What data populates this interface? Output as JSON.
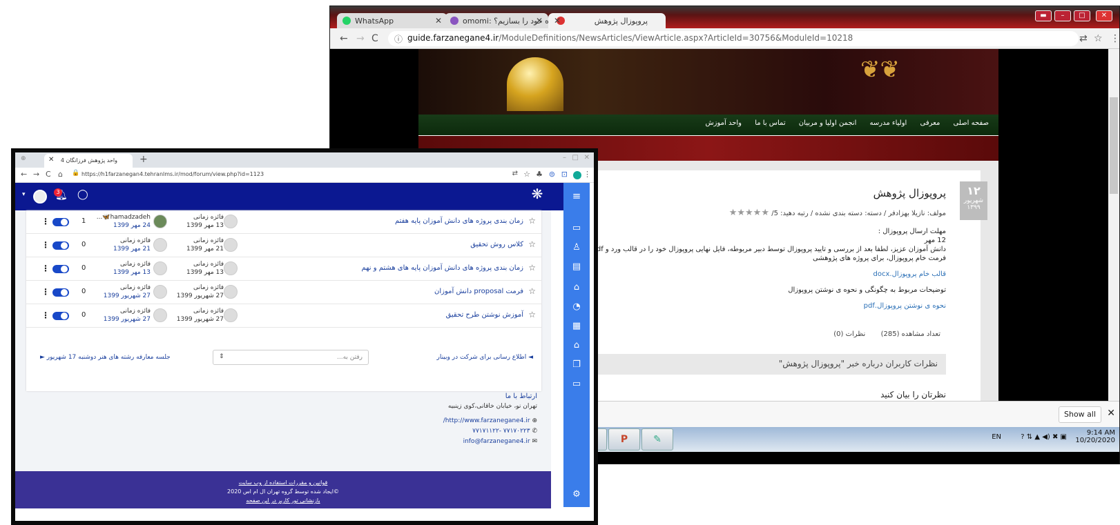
{
  "back": {
    "tabs": [
      {
        "label": "WhatsApp",
        "color": "#25d366"
      },
      {
        "label": "omomi: ه خود را بسازیم؟",
        "color": "#8a55c0"
      },
      {
        "label": "پروپوزال پژوهش",
        "color": "#d33"
      }
    ],
    "url_host": "guide.farzanegane4.ir",
    "url_path": "/ModuleDefinitions/NewsArticles/ViewArticle.aspx?ArticleId=30756&ModuleId=10218",
    "menu": [
      "صفحه اصلی",
      "معرفی",
      "اولیاء مدرسه",
      "انجمن اولیا و مربیان",
      "تماس با ما",
      "واحد آموزش"
    ],
    "date": {
      "day": "۱۲",
      "month": "شهریور",
      "year": "۱۳۹۹"
    },
    "title": "پروپوزال پژوهش",
    "meta": "مولف: نازیلا بهزادفر  /  دسته: دسته بندی نشده  /  رتبه دهید: 5/",
    "deadline_label": "مهلت ارسال پروپوزال :",
    "deadline_date": "12 مهر",
    "body": "دانش آموزان عزیز، لطفا بعد از  بررسی و تایید پروپوزال توسط دبیر مربوطه، فایل نهایی پروپوزال خود را در قالب ورد و pdf روی سامانه",
    "body2": "فرمت خام پروپوزال، برای پروژه های پژوهشی",
    "link1": "قالب خام پروپوزال.docx",
    "guide": "توضیحات مربوط به چگونگی و نحوه ی نوشتن پروپوزال",
    "link2": "نحوه ی نوشتن پروپوزال.pdf",
    "views": "تعداد مشاهده (285)",
    "comments": "نظرات (0)",
    "comment_header": "نظرات کاربران درباره خبر \"پروپوزال پژوهش\"",
    "tell": "نظرتان را بیان کنید",
    "show_all": "Show all",
    "tray_lang": "EN",
    "time": "9:14 AM",
    "date_tray": "10/20/2020"
  },
  "front": {
    "tab_title": "واحد پژوهش فرزانگان 4",
    "url": "https://h1farzanegan4.tehranlms.ir/mod/forum/view.php?id=1123",
    "notif_count": "3",
    "rows": [
      {
        "topic": "زمان بندی پروژه های دانش آموزان پایه هفتم",
        "starter": "فائزه زمانی",
        "start_date": "13 مهر 1399",
        "last": "hamadzadeh🦋...",
        "last_date": "24 مهر 1399",
        "count": "1"
      },
      {
        "topic": "کلاس روش تحقیق",
        "starter": "فائزه زمانی",
        "start_date": "21 مهر 1399",
        "last": "فائزه زمانی",
        "last_date": "21 مهر 1399",
        "count": "0"
      },
      {
        "topic": "زمان بندی پروژه های دانش آموزان پایه های هشتم و نهم",
        "starter": "فائزه زمانی",
        "start_date": "13 مهر 1399",
        "last": "فائزه زمانی",
        "last_date": "13 مهر 1399",
        "count": "0"
      },
      {
        "topic": "فرمت proposal دانش آموزان",
        "starter": "فائزه زمانی",
        "start_date": "27 شهریور 1399",
        "last": "فائزه زمانی",
        "last_date": "27 شهریور 1399",
        "count": "0"
      },
      {
        "topic": "آموزش نوشتن طرح تحقیق",
        "starter": "فائزه زمانی",
        "start_date": "27 شهریور 1399",
        "last": "فائزه زمانی",
        "last_date": "27 شهریور 1399",
        "count": "0"
      }
    ],
    "next_link": "◄ اطلاع رسانی برای شرکت در وبینار",
    "jump_placeholder": "رفتن به...",
    "prev_link": "جلسه معارفه رشته های هنر دوشنبه 17 شهریور ►",
    "contact_title": "ارتباط با ما",
    "address": "تهران نو، خیابان خاقانی،کوی زینبیه",
    "website": "http://www.farzanegane4.ir/",
    "phone": "۷۷۱۷۰۲۲۳ -۷۷۱۷۱۱۲۲",
    "email": "info@farzanegane4.ir",
    "footer_rules": "قوانین و مقررات استفاده از وب سایت",
    "footer_credit": "ایجاد شده توسط گروه تهران ال ام اس 2020©",
    "footer_tour": "بازنشانی تور کاربر در این صفحه"
  }
}
